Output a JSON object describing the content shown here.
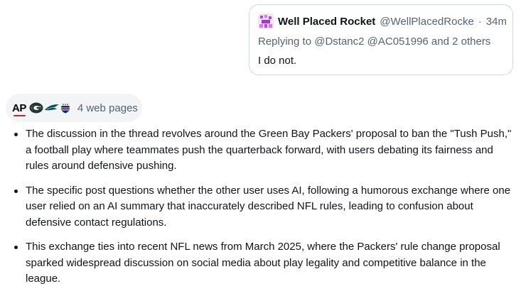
{
  "quote": {
    "name": "Well Placed Rocket",
    "handle": "@WellPlacedRocke",
    "separator": "·",
    "time": "34m",
    "reply": "Replying to @Dstanc2 @AC051996 and 2 others",
    "text": "I do not."
  },
  "sources": {
    "ap_label": "AP",
    "label": "4 web pages",
    "icons": [
      "ap-logo-icon",
      "packers-logo-icon",
      "eagles-logo-icon",
      "nfl-logo-icon"
    ]
  },
  "bullets": [
    "The discussion in the thread revolves around the Green Bay Packers' proposal to ban the \"Tush Push,\" a football play where teammates push the quarterback forward, with users debating its fairness and rules around defensive pushing.",
    "The specific post questions whether the other user uses AI, following a humorous exchange where one user relied on an AI summary that inaccurately described NFL rules, leading to confusion about defensive contact regulations.",
    "This exchange ties into recent NFL news from March 2025, where the Packers' rule change proposal sparked widespread discussion on social media about play legality and competitive balance in the league."
  ],
  "colors": {
    "text": "#0f1419",
    "muted": "#536471",
    "border": "#cfd9de",
    "pill_bg": "#f2f4f6",
    "ap_red": "#d21f2b",
    "packers_green": "#203731",
    "packers_gold": "#ffb612",
    "nfl_blue": "#013369",
    "avatar_purple": "#b14ad8"
  }
}
